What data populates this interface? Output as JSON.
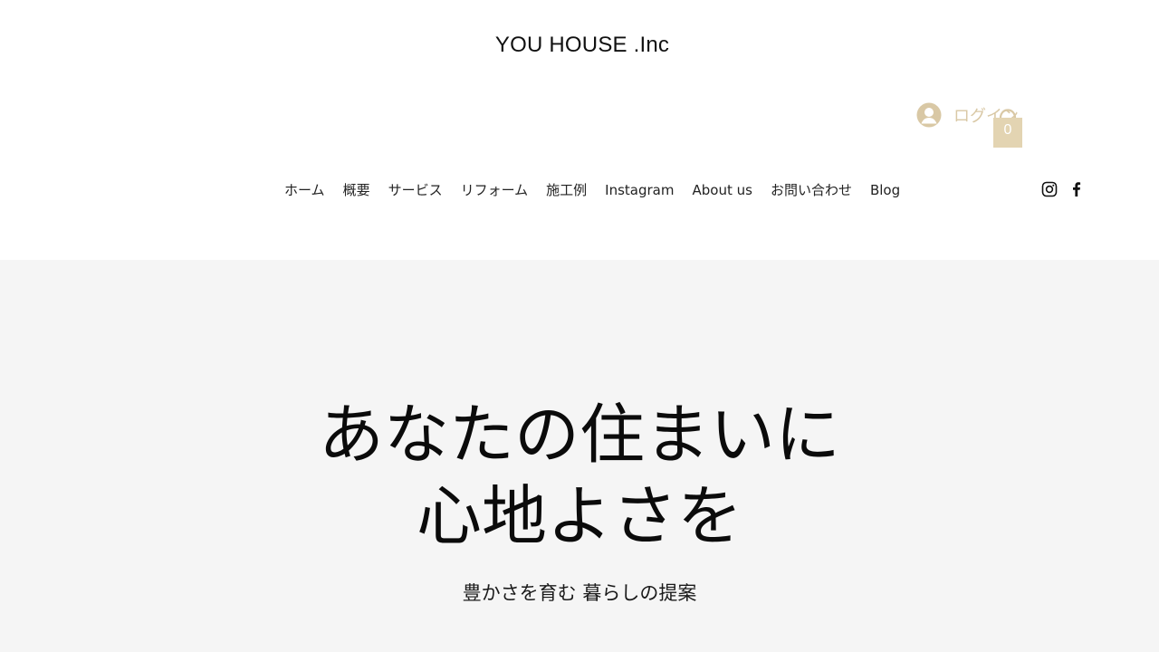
{
  "header": {
    "site_title": "YOU HOUSE .Inc",
    "login_label": "ログイン",
    "cart_count": "0",
    "nav_items": [
      "ホーム",
      "概要",
      "サービス",
      "リフォーム",
      "施工例",
      "Instagram",
      "About us",
      "お問い合わせ",
      "Blog"
    ],
    "social": [
      "instagram-icon",
      "facebook-icon"
    ]
  },
  "hero": {
    "heading_line1": "あなたの住まいに",
    "heading_line2": "心地よさを",
    "subheading": "豊かさを育む 暮らしの提案"
  },
  "colors": {
    "accent": "#d9c8a5",
    "hero_background": "#f5f5f5",
    "text": "#111111"
  }
}
